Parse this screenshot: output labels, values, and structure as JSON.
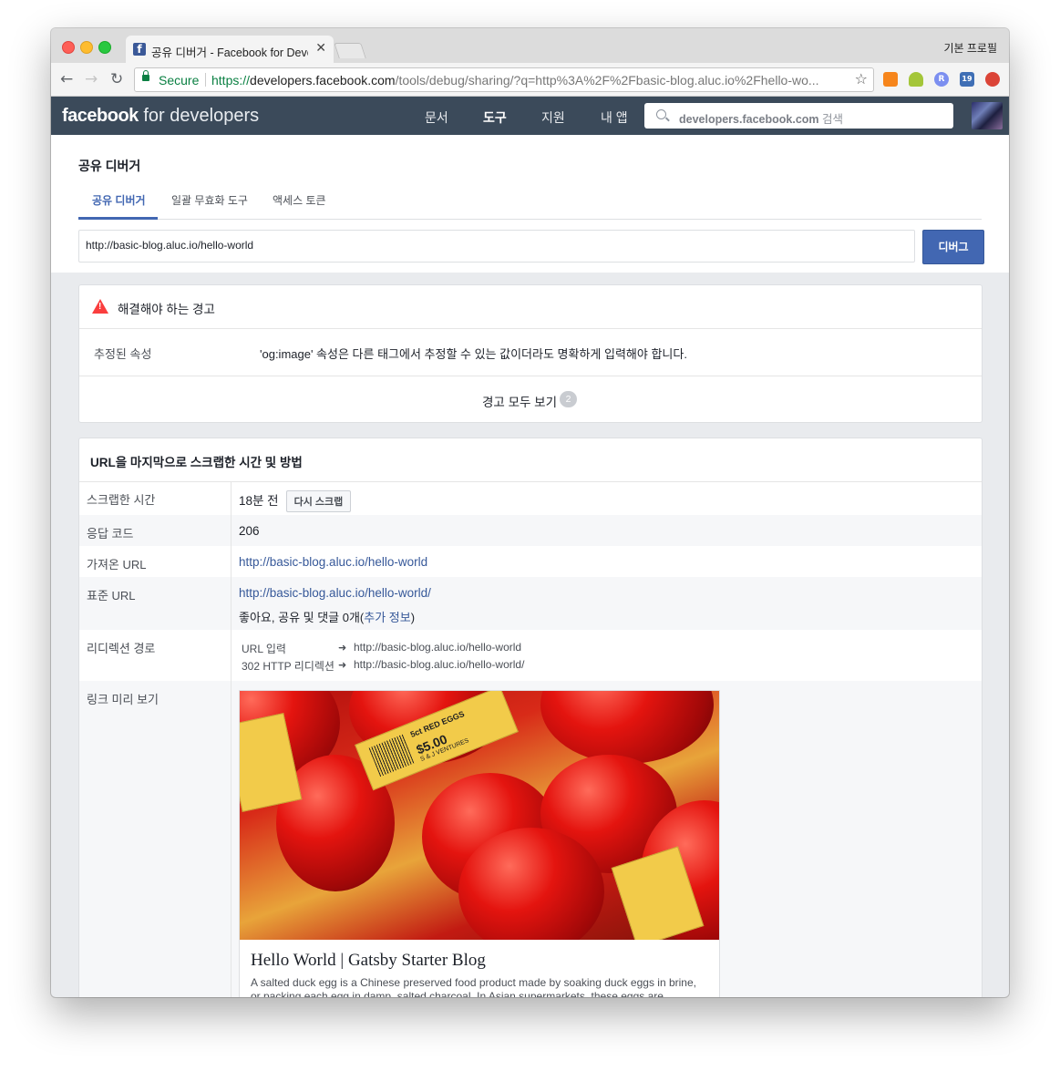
{
  "browser": {
    "tab_title": "공유 디버거 - Facebook for Developers",
    "profile": "기본 프로필",
    "address": {
      "secure_label": "Secure",
      "url_scheme": "https://",
      "url_host": "developers.facebook.com",
      "url_path": "/tools/debug/sharing/?q=http%3A%2F%2Fbasic-blog.aluc.io%2Fhello-wo..."
    },
    "ext_badge": "19",
    "ext_r_label": "R",
    "tab_close_glyph": "✕",
    "star_glyph": "☆"
  },
  "header": {
    "logo_bold": "facebook",
    "logo_rest": " for developers",
    "nav": [
      "문서",
      "도구",
      "지원",
      "내 앱"
    ],
    "search_host": "developers.facebook.com",
    "search_suffix": " 검색"
  },
  "debugger": {
    "title": "공유 디버거",
    "tabs": [
      "공유 디버거",
      "일괄 무효화 도구",
      "액세스 토큰"
    ],
    "url_value": "http://basic-blog.aluc.io/hello-world",
    "debug_button": "디버그"
  },
  "warnings": {
    "title": "해결해야 하는 경고",
    "row_label": "추정된 속성",
    "row_message": "'og:image' 속성은 다른 태그에서 추정할 수 있는 값이더라도 명확하게 입력해야 합니다.",
    "see_all": "경고 모두 보기",
    "count": "2"
  },
  "scrape": {
    "title": "URL을 마지막으로 스크랩한 시간 및 방법",
    "rows": {
      "time_label": "스크랩한 시간",
      "time_value": "18분 전",
      "rescrape_button": "다시 스크랩",
      "response_label": "응답 코드",
      "response_value": "206",
      "fetched_label": "가져온 URL",
      "fetched_value": "http://basic-blog.aluc.io/hello-world",
      "canonical_label": "표준 URL",
      "canonical_value": "http://basic-blog.aluc.io/hello-world/",
      "likes_prefix": "좋아요, 공유 및 댓글 0개(",
      "likes_link": "추가 정보",
      "likes_suffix": ")",
      "redirect_label": "리디렉션 경로",
      "redirects": [
        {
          "label": "URL 입력",
          "url": "http://basic-blog.aluc.io/hello-world"
        },
        {
          "label": "302 HTTP 리디렉션",
          "url": "http://basic-blog.aluc.io/hello-world/"
        }
      ],
      "preview_label": "링크 미리 보기"
    },
    "preview": {
      "title": "Hello World | Gatsby Starter Blog",
      "description": "A salted duck egg is a Chinese preserved food product made by soaking duck eggs in brine, or packing each egg in damp, salted charcoal. In Asian supermarkets, these eggs are",
      "tag_texts": [
        "$5.00",
        "5ct RED EGGS",
        "S & J VENTURES"
      ]
    }
  },
  "colors": {
    "fb_header": "#3b4a5a",
    "accent_blue": "#4267b2",
    "link_blue": "#365899",
    "warning_red": "#fa3e3e",
    "secure_green": "#0b8043"
  }
}
